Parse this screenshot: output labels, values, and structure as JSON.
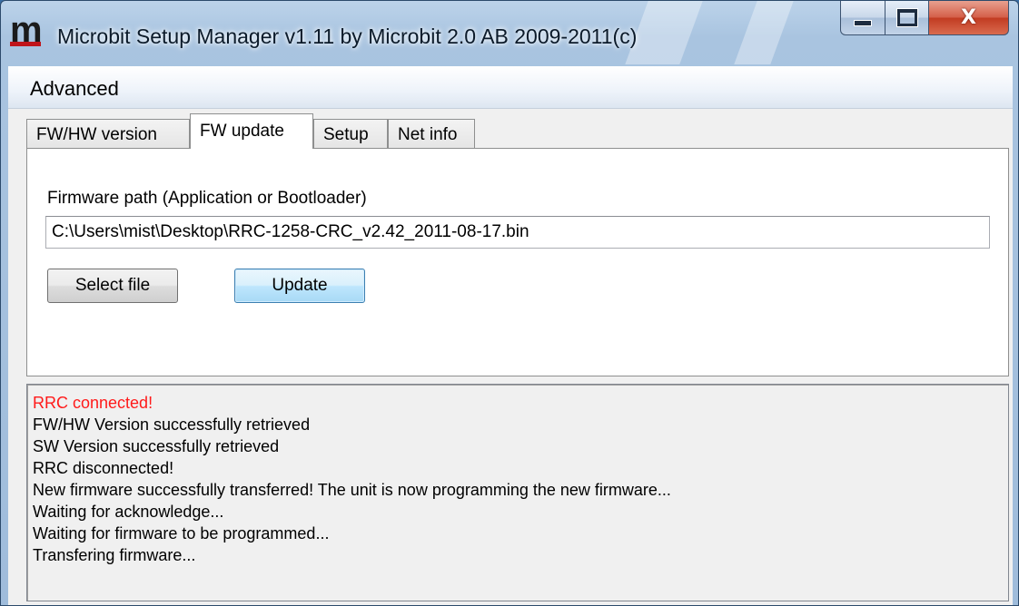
{
  "window": {
    "title": "Microbit Setup Manager v1.11 by Microbit 2.0 AB 2009-2011(c)",
    "logo_text": "m",
    "controls": {
      "close_label": "X"
    }
  },
  "menu": {
    "items": [
      {
        "label": "Advanced"
      }
    ]
  },
  "tabs": [
    {
      "label": "FW/HW version",
      "active": false
    },
    {
      "label": "FW update",
      "active": true
    },
    {
      "label": "Setup",
      "active": false
    },
    {
      "label": "Net info",
      "active": false
    }
  ],
  "fw_update": {
    "path_label": "Firmware path (Application or Bootloader)",
    "path_value": "C:\\Users\\mist\\Desktop\\RRC-1258-CRC_v2.42_2011-08-17.bin",
    "select_button": "Select file",
    "update_button": "Update"
  },
  "log": {
    "lines": [
      {
        "text": "RRC connected!",
        "color": "#ff1a1a"
      },
      {
        "text": "FW/HW Version successfully retrieved"
      },
      {
        "text": "SW Version successfully retrieved"
      },
      {
        "text": "RRC disconnected!"
      },
      {
        "text": "New firmware successfully transferred! The unit is now programming the new firmware..."
      },
      {
        "text": "Waiting for acknowledge..."
      },
      {
        "text": "Waiting for firmware to be programmed..."
      },
      {
        "text": "Transfering firmware..."
      }
    ]
  }
}
